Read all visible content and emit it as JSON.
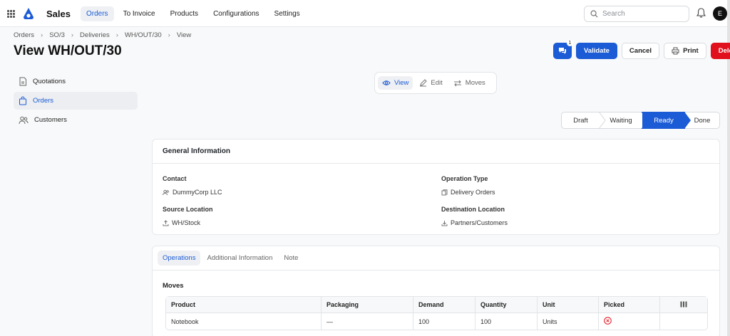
{
  "app": {
    "title": "Sales",
    "nav": [
      {
        "label": "Orders",
        "active": true
      },
      {
        "label": "To Invoice",
        "active": false
      },
      {
        "label": "Products",
        "active": false
      },
      {
        "label": "Configurations",
        "active": false
      },
      {
        "label": "Settings",
        "active": false
      }
    ],
    "search_placeholder": "Search",
    "avatar_initial": "E",
    "accent_color": "#1c5bd6",
    "danger_color": "#e1101d"
  },
  "breadcrumb": [
    "Orders",
    "SO/3",
    "Deliveries",
    "WH/OUT/30",
    "View"
  ],
  "page_title": "View WH/OUT/30",
  "actions": {
    "chat_count": "1",
    "validate": "Validate",
    "cancel": "Cancel",
    "print": "Print",
    "delete": "Delete"
  },
  "sidebar": [
    {
      "label": "Quotations",
      "icon": "document-icon",
      "active": false
    },
    {
      "label": "Orders",
      "icon": "bag-icon",
      "active": true
    },
    {
      "label": "Customers",
      "icon": "users-icon",
      "active": false
    }
  ],
  "view_switch": [
    {
      "label": "View",
      "icon": "eye-icon",
      "active": true
    },
    {
      "label": "Edit",
      "icon": "pencil-icon",
      "active": false
    },
    {
      "label": "Moves",
      "icon": "arrows-icon",
      "active": false
    }
  ],
  "status_stages": [
    {
      "label": "Draft",
      "active": false
    },
    {
      "label": "Waiting",
      "active": false
    },
    {
      "label": "Ready",
      "active": true
    },
    {
      "label": "Done",
      "active": false
    }
  ],
  "general_info": {
    "title": "General Information",
    "contact_label": "Contact",
    "contact_value": "DummyCorp LLC",
    "operation_type_label": "Operation Type",
    "operation_type_value": "Delivery Orders",
    "source_label": "Source Location",
    "source_value": "WH/Stock",
    "destination_label": "Destination Location",
    "destination_value": "Partners/Customers"
  },
  "tabs": [
    {
      "label": "Operations",
      "active": true
    },
    {
      "label": "Additional Information",
      "active": false
    },
    {
      "label": "Note",
      "active": false
    }
  ],
  "moves": {
    "title": "Moves",
    "columns": [
      "Product",
      "Packaging",
      "Demand",
      "Quantity",
      "Unit",
      "Picked"
    ],
    "rows": [
      {
        "product": "Notebook",
        "packaging": "—",
        "demand": "100",
        "quantity": "100",
        "unit": "Units",
        "picked": false
      }
    ]
  }
}
